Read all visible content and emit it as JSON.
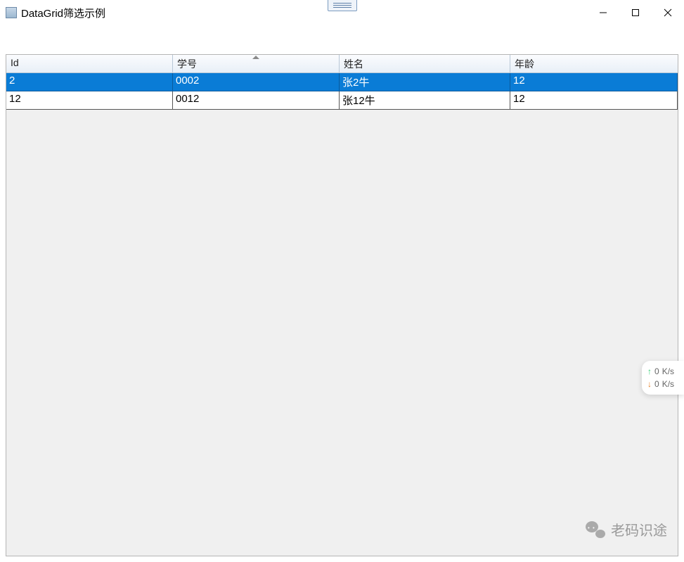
{
  "window": {
    "title": "DataGrid筛选示例"
  },
  "grid": {
    "columns": [
      {
        "label": "Id",
        "sorted": false
      },
      {
        "label": "学号",
        "sorted": true
      },
      {
        "label": "姓名",
        "sorted": false
      },
      {
        "label": "年龄",
        "sorted": false
      }
    ],
    "rows": [
      {
        "selected": true,
        "id": "2",
        "sno": "0002",
        "name": "张2牛",
        "age": "12"
      },
      {
        "selected": false,
        "id": "12",
        "sno": "0012",
        "name": "张12牛",
        "age": "12"
      }
    ]
  },
  "network": {
    "up": {
      "value": "0",
      "unit": "K/s"
    },
    "down": {
      "value": "0",
      "unit": "K/s"
    }
  },
  "watermark": {
    "text": "老码识途"
  }
}
